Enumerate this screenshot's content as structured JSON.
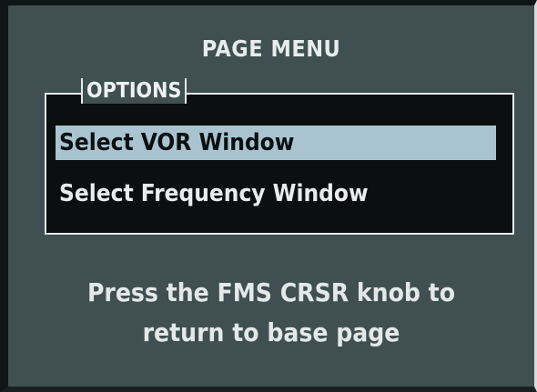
{
  "page_menu": {
    "title": "PAGE MENU",
    "options_label": "OPTIONS",
    "items": [
      {
        "label": "Select VOR Window",
        "selected": true
      },
      {
        "label": "Select Frequency Window",
        "selected": false
      }
    ],
    "instruction_line1": "Press the FMS CRSR knob to",
    "instruction_line2": "return to base page"
  },
  "colors": {
    "panel_background": "#3f4f52",
    "options_background": "#0b0f10",
    "selection_highlight": "#a9c4d0",
    "text": "#e8ecec"
  }
}
